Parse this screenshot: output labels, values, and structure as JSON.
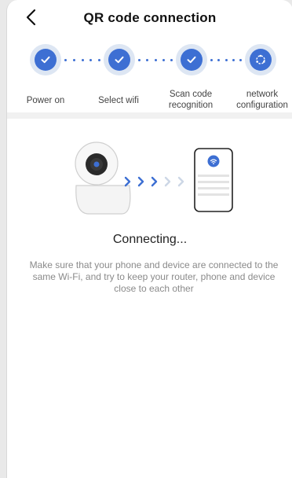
{
  "header": {
    "title": "QR code connection"
  },
  "steps": [
    {
      "label": "Power on",
      "state": "done",
      "icon": "checkmark-icon"
    },
    {
      "label": "Select wifi",
      "state": "done",
      "icon": "checkmark-icon"
    },
    {
      "label": "Scan code recognition",
      "state": "done",
      "icon": "checkmark-icon"
    },
    {
      "label": "network configuration",
      "state": "in-progress",
      "icon": "spinner-icon"
    }
  ],
  "status": {
    "text": "Connecting...",
    "hint": "Make sure that your phone and device are connected to the same Wi-Fi, and try to keep your router, phone and device close to each other"
  },
  "colors": {
    "accent": "#3d6fd3",
    "accent_light": "#dde6f3",
    "hint_text": "#8a8a8a"
  }
}
